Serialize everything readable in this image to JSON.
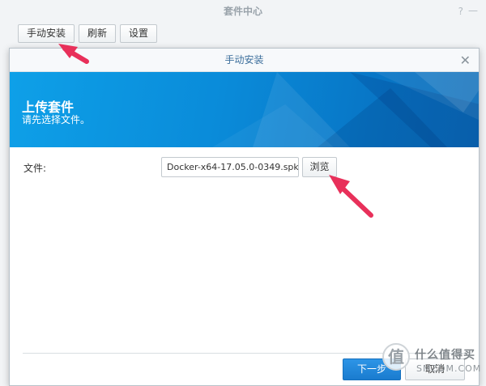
{
  "app": {
    "title": "套件中心",
    "help_icon": "?",
    "minimize_icon": "—"
  },
  "toolbar": {
    "manual_install": "手动安装",
    "refresh": "刷新",
    "settings": "设置"
  },
  "dialog": {
    "title": "手动安装",
    "close_icon": "✕",
    "banner_title": "上传套件",
    "banner_subtitle": "请先选择文件。",
    "file_label": "文件:",
    "file_value": "Docker-x64-17.05.0-0349.spk",
    "browse_label": "浏览",
    "next_label": "下一步",
    "cancel_label": "取消"
  },
  "watermark": {
    "logo": "值",
    "line1": "什么值得买",
    "line2": "SMZDM.COM"
  },
  "colors": {
    "accent_blue": "#1a7ccf",
    "annotation_pink": "#e8305a"
  }
}
